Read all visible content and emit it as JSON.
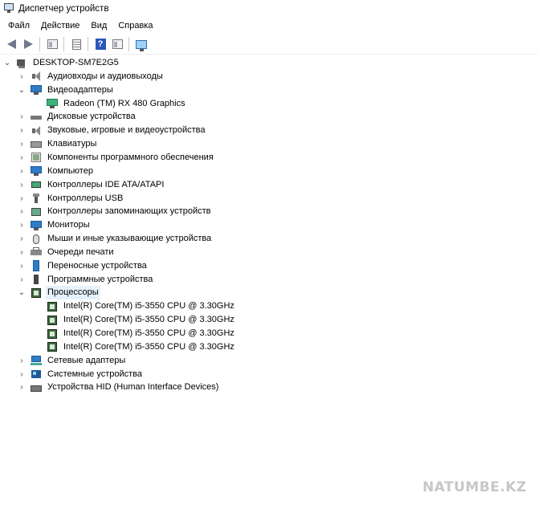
{
  "window": {
    "title": "Диспетчер устройств"
  },
  "menu": [
    "Файл",
    "Действие",
    "Вид",
    "Справка"
  ],
  "toolbar": {
    "buttons": [
      {
        "icon": "back-arrow-icon"
      },
      {
        "icon": "forward-arrow-icon"
      },
      {
        "icon": "properties-icon"
      },
      {
        "icon": "list-icon"
      },
      {
        "icon": "help-icon",
        "glyph": "?"
      },
      {
        "icon": "view-icon"
      },
      {
        "icon": "scan-hardware-icon"
      }
    ]
  },
  "tree": {
    "root": "DESKTOP-SM7E2G5",
    "items": [
      {
        "label": "Аудиовходы и аудиовыходы",
        "icon": "audio",
        "expanded": false,
        "children": []
      },
      {
        "label": "Видеоадаптеры",
        "icon": "monitor",
        "expanded": true,
        "children": [
          "Radeon (TM) RX 480 Graphics"
        ]
      },
      {
        "label": "Дисковые устройства",
        "icon": "disk",
        "expanded": false,
        "children": []
      },
      {
        "label": "Звуковые, игровые и видеоустройства",
        "icon": "audio",
        "expanded": false,
        "children": []
      },
      {
        "label": "Клавиатуры",
        "icon": "kbd",
        "expanded": false,
        "children": []
      },
      {
        "label": "Компоненты программного обеспечения",
        "icon": "soft",
        "expanded": false,
        "children": []
      },
      {
        "label": "Компьютер",
        "icon": "monitor",
        "expanded": false,
        "children": []
      },
      {
        "label": "Контроллеры IDE ATA/ATAPI",
        "icon": "ide",
        "expanded": false,
        "children": []
      },
      {
        "label": "Контроллеры USB",
        "icon": "usb",
        "expanded": false,
        "children": []
      },
      {
        "label": "Контроллеры запоминающих устройств",
        "icon": "storage",
        "expanded": false,
        "children": []
      },
      {
        "label": "Мониторы",
        "icon": "monitor",
        "expanded": false,
        "children": []
      },
      {
        "label": "Мыши и иные указывающие устройства",
        "icon": "mouse",
        "expanded": false,
        "children": []
      },
      {
        "label": "Очереди печати",
        "icon": "print",
        "expanded": false,
        "children": []
      },
      {
        "label": "Переносные устройства",
        "icon": "portable",
        "expanded": false,
        "children": []
      },
      {
        "label": "Программные устройства",
        "icon": "firmware",
        "expanded": false,
        "children": []
      },
      {
        "label": "Процессоры",
        "icon": "cpu",
        "expanded": true,
        "selected": true,
        "children": [
          "Intel(R) Core(TM) i5-3550 CPU @ 3.30GHz",
          "Intel(R) Core(TM) i5-3550 CPU @ 3.30GHz",
          "Intel(R) Core(TM) i5-3550 CPU @ 3.30GHz",
          "Intel(R) Core(TM) i5-3550 CPU @ 3.30GHz"
        ]
      },
      {
        "label": "Сетевые адаптеры",
        "icon": "net",
        "expanded": false,
        "children": []
      },
      {
        "label": "Системные устройства",
        "icon": "system",
        "expanded": false,
        "children": []
      },
      {
        "label": "Устройства HID (Human Interface Devices)",
        "icon": "hid",
        "expanded": false,
        "children": []
      }
    ]
  },
  "watermark": "NATUMBE.KZ",
  "colors": {
    "selection": "#e5f1fb",
    "accent": "#2f7cc7"
  }
}
